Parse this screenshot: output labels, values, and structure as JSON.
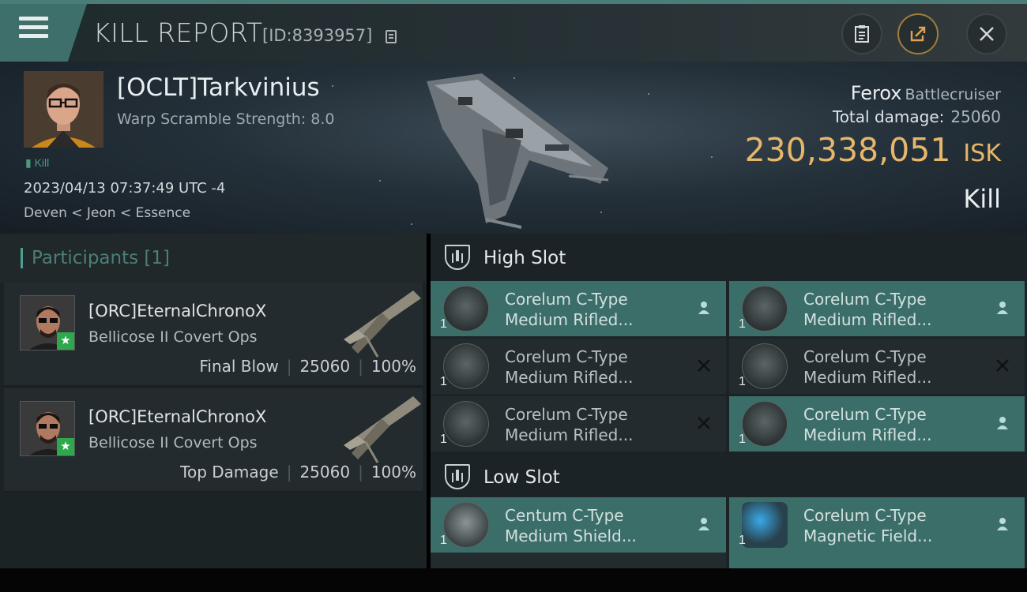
{
  "header": {
    "title": "KILL REPORT",
    "kill_id": "[ID:8393957]"
  },
  "victim": {
    "pilot": "[OCLT]Tarkvinius",
    "warp_scramble": "Warp Scramble Strength: 8.0",
    "tag": "Kill",
    "timestamp": "2023/04/13 07:37:49 UTC -4",
    "location": "Deven < Jeon < Essence",
    "ship": "Ferox",
    "ship_class": "Battlecruiser",
    "total_damage_label": "Total damage:",
    "total_damage": "25060",
    "isk_value": "230,338,051",
    "isk_unit": "ISK",
    "result": "Kill"
  },
  "participants": {
    "title": "Participants",
    "count": "[1]",
    "items": [
      {
        "name": "[ORC]EternalChronoX",
        "ship": "Bellicose II Covert Ops",
        "role": "Final Blow",
        "damage": "25060",
        "percent": "100%"
      },
      {
        "name": "[ORC]EternalChronoX",
        "ship": "Bellicose II Covert Ops",
        "role": "Top Damage",
        "damage": "25060",
        "percent": "100%"
      }
    ]
  },
  "slots": {
    "high": {
      "label": "High Slot",
      "modules": [
        {
          "line1": "Corelum C-Type",
          "line2": "Medium Rifled...",
          "qty": "1",
          "status": "fitted"
        },
        {
          "line1": "Corelum C-Type",
          "line2": "Medium Rifled...",
          "qty": "1",
          "status": "fitted"
        },
        {
          "line1": "Corelum C-Type",
          "line2": "Medium Rifled...",
          "qty": "1",
          "status": "destroyed"
        },
        {
          "line1": "Corelum C-Type",
          "line2": "Medium Rifled...",
          "qty": "1",
          "status": "destroyed"
        },
        {
          "line1": "Corelum C-Type",
          "line2": "Medium Rifled...",
          "qty": "1",
          "status": "destroyed"
        },
        {
          "line1": "Corelum C-Type",
          "line2": "Medium Rifled...",
          "qty": "1",
          "status": "fitted"
        }
      ]
    },
    "low": {
      "label": "Low Slot",
      "modules": [
        {
          "line1": "Centum C-Type",
          "line2": "Medium Shield...",
          "qty": "1",
          "status": "fitted"
        },
        {
          "line1": "Corelum C-Type",
          "line2": "Magnetic Field...",
          "qty": "1",
          "status": "fitted"
        }
      ]
    }
  },
  "colors": {
    "accent": "#3c6e69",
    "isk": "#e6b66a",
    "badge": "#2fa84d"
  }
}
